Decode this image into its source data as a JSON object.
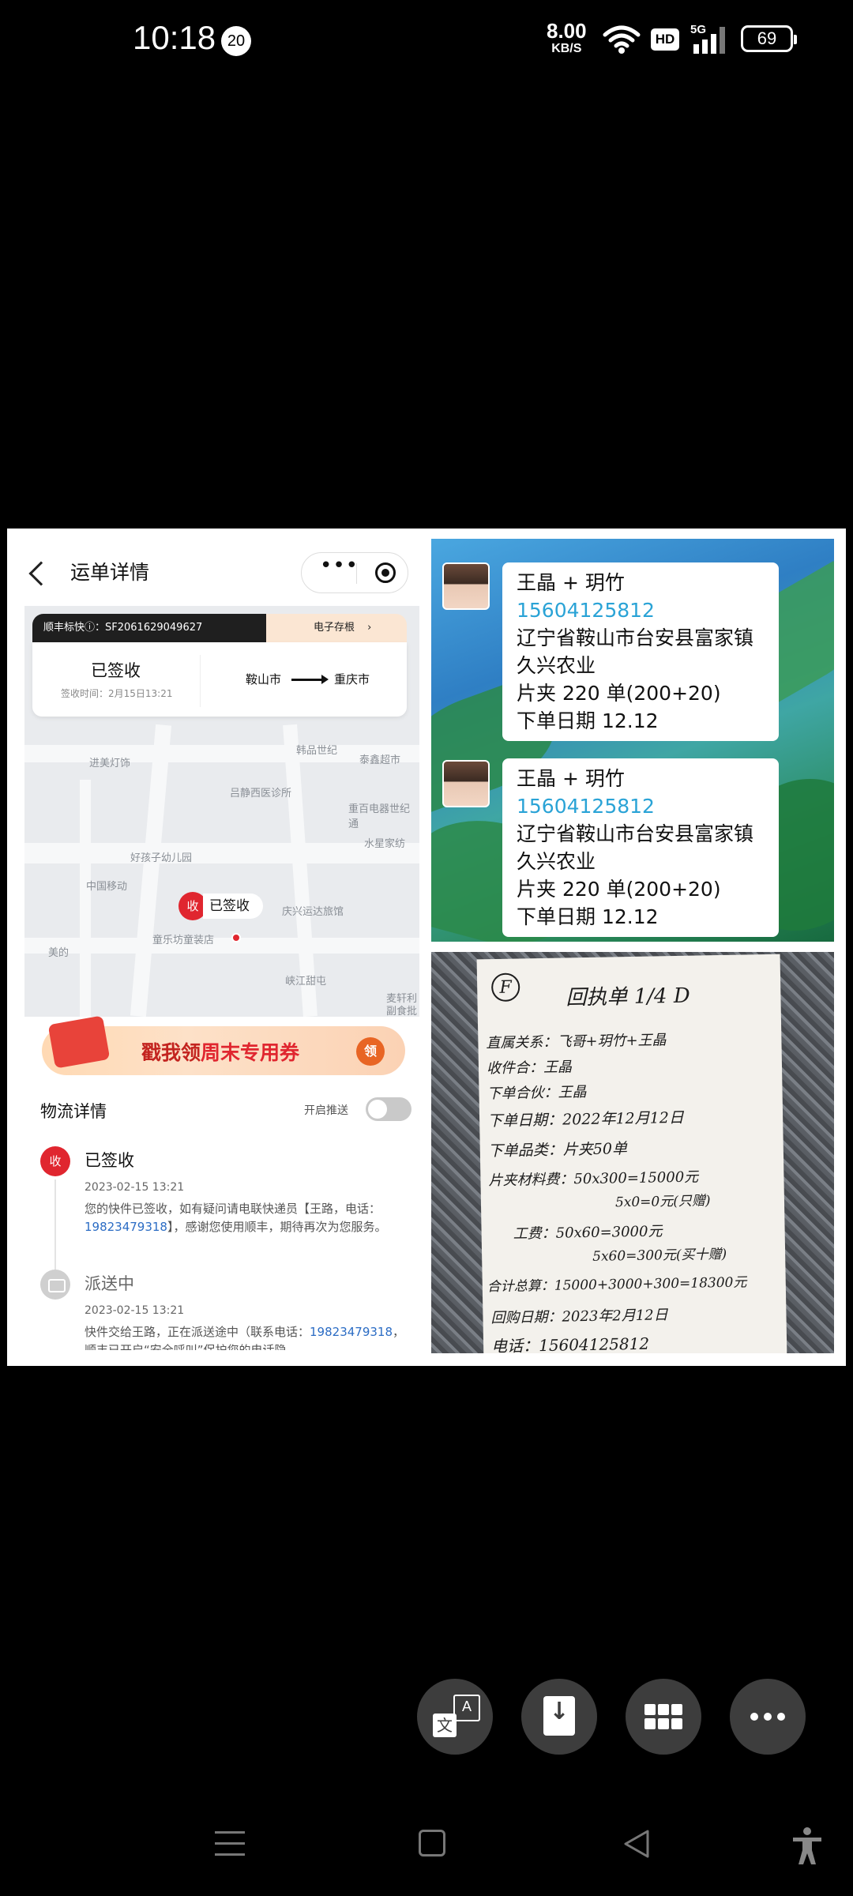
{
  "status_bar": {
    "time": "10:18",
    "notification_count": "20",
    "net_speed_value": "8.00",
    "net_speed_unit": "KB/S",
    "hd_label": "HD",
    "network": "5G",
    "battery": "69"
  },
  "waybill": {
    "nav_title": "运单详情",
    "capsule_more": "•••",
    "waybill_label": "顺丰标快ⓘ：SF2061629049627",
    "eform_label": "电子存根",
    "status": "已签收",
    "sign_time": "签收时间：2月15日13:21",
    "from_city": "鞍山市",
    "to_city": "重庆市",
    "map_labels": [
      "韩品世纪",
      "泰鑫超市",
      "进美灯饰",
      "吕静西医诊所",
      "重百电器世纪通",
      "水星家纺",
      "好孩子幼儿园",
      "中国移动",
      "庆兴运达旅馆",
      "童乐坊童装店",
      "美的",
      "峡江甜屯",
      "麦轩利",
      "副食批"
    ],
    "pin_icon": "收",
    "pin_label": "已签收",
    "coupon_prefix": "戳我领",
    "coupon_highlight": "周末专用券",
    "coupon_badge": "领",
    "logistics_title": "物流详情",
    "push_label": "开启推送",
    "steps": [
      {
        "icon": "收",
        "title": "已签收",
        "time": "2023-02-15 13:21",
        "desc_before": "您的快件已签收，如有疑问请电联快递员【王路，电话：",
        "phone": "19823479318",
        "desc_after": "】，感谢您使用顺丰，期待再次为您服务。"
      },
      {
        "title": "派送中",
        "time": "2023-02-15 13:21",
        "desc_before": "快件交给王路，正在派送途中（联系电话：",
        "phone": "19823479318",
        "desc_after": "，顺丰已开启“安全呼叫”保护您的电话隐"
      }
    ]
  },
  "chat": {
    "messages": [
      {
        "name": "王晶 + 玥竹",
        "phone": "15604125812",
        "address": "辽宁省鞍山市台安县富家镇久兴农业",
        "order": "片夹 220 单(200+20)",
        "date": "下单日期 12.12"
      },
      {
        "name": "王晶 + 玥竹",
        "phone": "15604125812",
        "address": "辽宁省鞍山市台安县富家镇久兴农业",
        "order": "片夹 220 单(200+20)",
        "date": "下单日期 12.12"
      }
    ]
  },
  "note": {
    "mark": "F",
    "title": "回执单 1/4 D",
    "lines": [
      "直属关系：飞哥+玥竹+王晶",
      "收件合：王晶",
      "下单合伙：王晶",
      "下单日期：2022年12月12日",
      "下单品类：片夹50单",
      "片夹材料费：50x300=15000元",
      "5x0=0元(只赠)",
      "工费：50x60=3000元",
      "5x60=300元(买十赠)",
      "合计总算：15000+3000+300=18300元",
      "回购日期：2023年2月12日",
      "电话：15604125812"
    ]
  },
  "fabs": {
    "translate_icon": "translate-icon",
    "save_icon": "download-icon",
    "grid_icon": "grid-icon",
    "more_icon": "more-icon"
  }
}
